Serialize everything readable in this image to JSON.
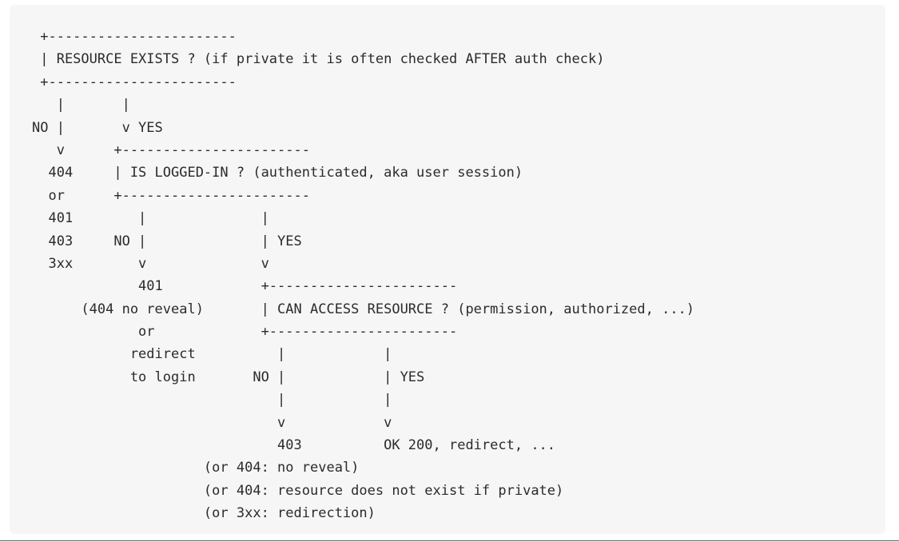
{
  "diagram": {
    "lines": [
      " +-----------------------",
      " | RESOURCE EXISTS ? (if private it is often checked AFTER auth check)",
      " +-----------------------",
      "   |       |",
      "NO |       v YES",
      "   v      +-----------------------",
      "  404     | IS LOGGED-IN ? (authenticated, aka user session)",
      "  or      +-----------------------",
      "  401        |              |",
      "  403     NO |              | YES",
      "  3xx        v              v",
      "             401            +-----------------------",
      "      (404 no reveal)       | CAN ACCESS RESOURCE ? (permission, authorized, ...)",
      "             or             +-----------------------",
      "            redirect          |            |",
      "            to login       NO |            | YES",
      "                              |            |",
      "                              v            v",
      "                              403          OK 200, redirect, ...",
      "                     (or 404: no reveal)",
      "                     (or 404: resource does not exist if private)",
      "                     (or 3xx: redirection)"
    ]
  }
}
